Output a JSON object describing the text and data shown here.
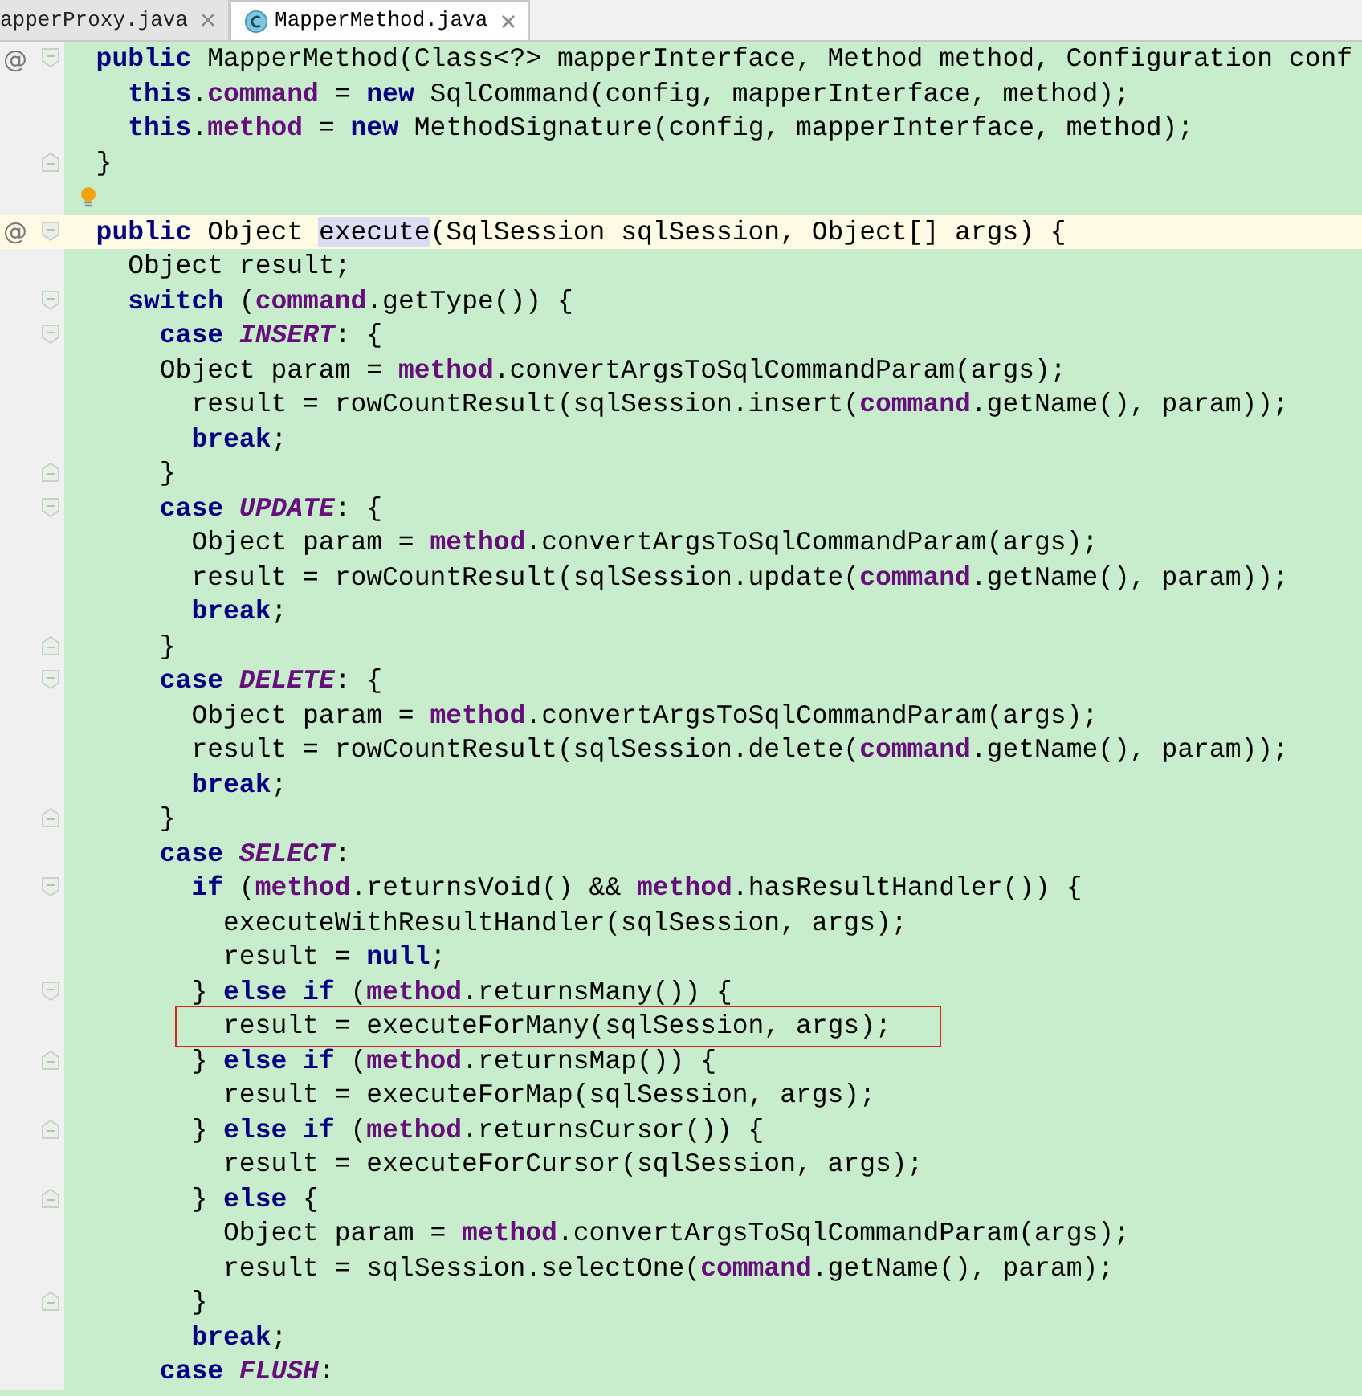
{
  "tabs": [
    {
      "label": "apperProxy.java",
      "selected": false,
      "icon": false
    },
    {
      "label": "MapperMethod.java",
      "selected": true,
      "icon": true
    }
  ],
  "editor": {
    "lines": [
      {
        "gutter_mark": "@",
        "fold_start": true,
        "tokens": [
          {
            "kind": "keyword",
            "t": "  public"
          },
          {
            "kind": "plain",
            "t": " MapperMethod(Class<?> mapperInterface, Method method, Configuration conf"
          }
        ]
      },
      {
        "tokens": [
          {
            "kind": "keyword",
            "t": "    this"
          },
          {
            "kind": "plain",
            "t": "."
          },
          {
            "kind": "field",
            "t": "command"
          },
          {
            "kind": "plain",
            "t": " = "
          },
          {
            "kind": "keyword",
            "t": "new"
          },
          {
            "kind": "plain",
            "t": " SqlCommand(config, mapperInterface, method);"
          }
        ]
      },
      {
        "tokens": [
          {
            "kind": "keyword",
            "t": "    this"
          },
          {
            "kind": "plain",
            "t": "."
          },
          {
            "kind": "field",
            "t": "method"
          },
          {
            "kind": "plain",
            "t": " = "
          },
          {
            "kind": "keyword",
            "t": "new"
          },
          {
            "kind": "plain",
            "t": " MethodSignature(config, mapperInterface, method);"
          }
        ]
      },
      {
        "fold_end": true,
        "tokens": [
          {
            "kind": "plain",
            "t": "  }"
          }
        ]
      },
      {
        "bulb": true
      },
      {
        "gutter_mark": "@",
        "fold_start": true,
        "current": true,
        "tokens": [
          {
            "kind": "keyword",
            "t": "  public"
          },
          {
            "kind": "plain",
            "t": " Object "
          },
          {
            "kind": "usage",
            "t": "execute"
          },
          {
            "kind": "plain",
            "t": "(SqlSession sqlSession, Object[] args) {"
          }
        ]
      },
      {
        "tokens": [
          {
            "kind": "plain",
            "t": "    Object result;"
          }
        ]
      },
      {
        "fold_start": true,
        "tokens": [
          {
            "kind": "keyword",
            "t": "    switch"
          },
          {
            "kind": "plain",
            "t": " ("
          },
          {
            "kind": "field",
            "t": "command"
          },
          {
            "kind": "plain",
            "t": ".getType()) {"
          }
        ]
      },
      {
        "fold_start": true,
        "tokens": [
          {
            "kind": "keyword",
            "t": "      case"
          },
          {
            "kind": "constant",
            "t": " INSERT"
          },
          {
            "kind": "plain",
            "t": ": {"
          }
        ]
      },
      {
        "tokens": [
          {
            "kind": "plain",
            "t": "      Object param = "
          },
          {
            "kind": "field",
            "t": "method"
          },
          {
            "kind": "plain",
            "t": ".convertArgsToSqlCommandParam(args);"
          }
        ]
      },
      {
        "tokens": [
          {
            "kind": "plain",
            "t": "        result = rowCountResult(sqlSession.insert("
          },
          {
            "kind": "field",
            "t": "command"
          },
          {
            "kind": "plain",
            "t": ".getName(), param));"
          }
        ]
      },
      {
        "tokens": [
          {
            "kind": "keyword",
            "t": "        break"
          },
          {
            "kind": "plain",
            "t": ";"
          }
        ]
      },
      {
        "fold_end": true,
        "tokens": [
          {
            "kind": "plain",
            "t": "      }"
          }
        ]
      },
      {
        "fold_start": true,
        "tokens": [
          {
            "kind": "keyword",
            "t": "      case"
          },
          {
            "kind": "constant",
            "t": " UPDATE"
          },
          {
            "kind": "plain",
            "t": ": {"
          }
        ]
      },
      {
        "tokens": [
          {
            "kind": "plain",
            "t": "        Object param = "
          },
          {
            "kind": "field",
            "t": "method"
          },
          {
            "kind": "plain",
            "t": ".convertArgsToSqlCommandParam(args);"
          }
        ]
      },
      {
        "tokens": [
          {
            "kind": "plain",
            "t": "        result = rowCountResult(sqlSession.update("
          },
          {
            "kind": "field",
            "t": "command"
          },
          {
            "kind": "plain",
            "t": ".getName(), param));"
          }
        ]
      },
      {
        "tokens": [
          {
            "kind": "keyword",
            "t": "        break"
          },
          {
            "kind": "plain",
            "t": ";"
          }
        ]
      },
      {
        "fold_end": true,
        "tokens": [
          {
            "kind": "plain",
            "t": "      }"
          }
        ]
      },
      {
        "fold_start": true,
        "tokens": [
          {
            "kind": "keyword",
            "t": "      case"
          },
          {
            "kind": "constant",
            "t": " DELETE"
          },
          {
            "kind": "plain",
            "t": ": {"
          }
        ]
      },
      {
        "tokens": [
          {
            "kind": "plain",
            "t": "        Object param = "
          },
          {
            "kind": "field",
            "t": "method"
          },
          {
            "kind": "plain",
            "t": ".convertArgsToSqlCommandParam(args);"
          }
        ]
      },
      {
        "tokens": [
          {
            "kind": "plain",
            "t": "        result = rowCountResult(sqlSession.delete("
          },
          {
            "kind": "field",
            "t": "command"
          },
          {
            "kind": "plain",
            "t": ".getName(), param));"
          }
        ]
      },
      {
        "tokens": [
          {
            "kind": "keyword",
            "t": "        break"
          },
          {
            "kind": "plain",
            "t": ";"
          }
        ]
      },
      {
        "fold_end": true,
        "tokens": [
          {
            "kind": "plain",
            "t": "      }"
          }
        ]
      },
      {
        "tokens": [
          {
            "kind": "keyword",
            "t": "      case"
          },
          {
            "kind": "constant",
            "t": " SELECT"
          },
          {
            "kind": "plain",
            "t": ":"
          }
        ]
      },
      {
        "fold_start": true,
        "tokens": [
          {
            "kind": "keyword",
            "t": "        if"
          },
          {
            "kind": "plain",
            "t": " ("
          },
          {
            "kind": "field",
            "t": "method"
          },
          {
            "kind": "plain",
            "t": ".returnsVoid() && "
          },
          {
            "kind": "field",
            "t": "method"
          },
          {
            "kind": "plain",
            "t": ".hasResultHandler()) {"
          }
        ]
      },
      {
        "tokens": [
          {
            "kind": "plain",
            "t": "          executeWithResultHandler(sqlSession, args);"
          }
        ]
      },
      {
        "tokens": [
          {
            "kind": "plain",
            "t": "          result = "
          },
          {
            "kind": "keyword",
            "t": "null"
          },
          {
            "kind": "plain",
            "t": ";"
          }
        ]
      },
      {
        "fold_start": true,
        "tokens": [
          {
            "kind": "plain",
            "t": "        } "
          },
          {
            "kind": "keyword",
            "t": "else if"
          },
          {
            "kind": "plain",
            "t": " ("
          },
          {
            "kind": "field",
            "t": "method"
          },
          {
            "kind": "plain",
            "t": ".returnsMany()) {"
          }
        ]
      },
      {
        "boxed": true,
        "tokens": [
          {
            "kind": "plain",
            "t": "          result = executeForMany(sqlSession, args);"
          }
        ]
      },
      {
        "fold_end": true,
        "tokens": [
          {
            "kind": "plain",
            "t": "        } "
          },
          {
            "kind": "keyword",
            "t": "else if"
          },
          {
            "kind": "plain",
            "t": " ("
          },
          {
            "kind": "field",
            "t": "method"
          },
          {
            "kind": "plain",
            "t": ".returnsMap()) {"
          }
        ]
      },
      {
        "tokens": [
          {
            "kind": "plain",
            "t": "          result = executeForMap(sqlSession, args);"
          }
        ]
      },
      {
        "fold_end": true,
        "tokens": [
          {
            "kind": "plain",
            "t": "        } "
          },
          {
            "kind": "keyword",
            "t": "else if"
          },
          {
            "kind": "plain",
            "t": " ("
          },
          {
            "kind": "field",
            "t": "method"
          },
          {
            "kind": "plain",
            "t": ".returnsCursor()) {"
          }
        ]
      },
      {
        "tokens": [
          {
            "kind": "plain",
            "t": "          result = executeForCursor(sqlSession, args);"
          }
        ]
      },
      {
        "fold_end": true,
        "tokens": [
          {
            "kind": "plain",
            "t": "        } "
          },
          {
            "kind": "keyword",
            "t": "else"
          },
          {
            "kind": "plain",
            "t": " {"
          }
        ]
      },
      {
        "tokens": [
          {
            "kind": "plain",
            "t": "          Object param = "
          },
          {
            "kind": "field",
            "t": "method"
          },
          {
            "kind": "plain",
            "t": ".convertArgsToSqlCommandParam(args);"
          }
        ]
      },
      {
        "tokens": [
          {
            "kind": "plain",
            "t": "          result = sqlSession.selectOne("
          },
          {
            "kind": "field",
            "t": "command"
          },
          {
            "kind": "plain",
            "t": ".getName(), param);"
          }
        ]
      },
      {
        "fold_end": true,
        "tokens": [
          {
            "kind": "plain",
            "t": "        }"
          }
        ]
      },
      {
        "tokens": [
          {
            "kind": "keyword",
            "t": "        break"
          },
          {
            "kind": "plain",
            "t": ";"
          }
        ]
      },
      {
        "tokens": [
          {
            "kind": "keyword",
            "t": "      case"
          },
          {
            "kind": "constant",
            "t": " FLUSH"
          },
          {
            "kind": "plain",
            "t": ":"
          }
        ]
      }
    ]
  }
}
